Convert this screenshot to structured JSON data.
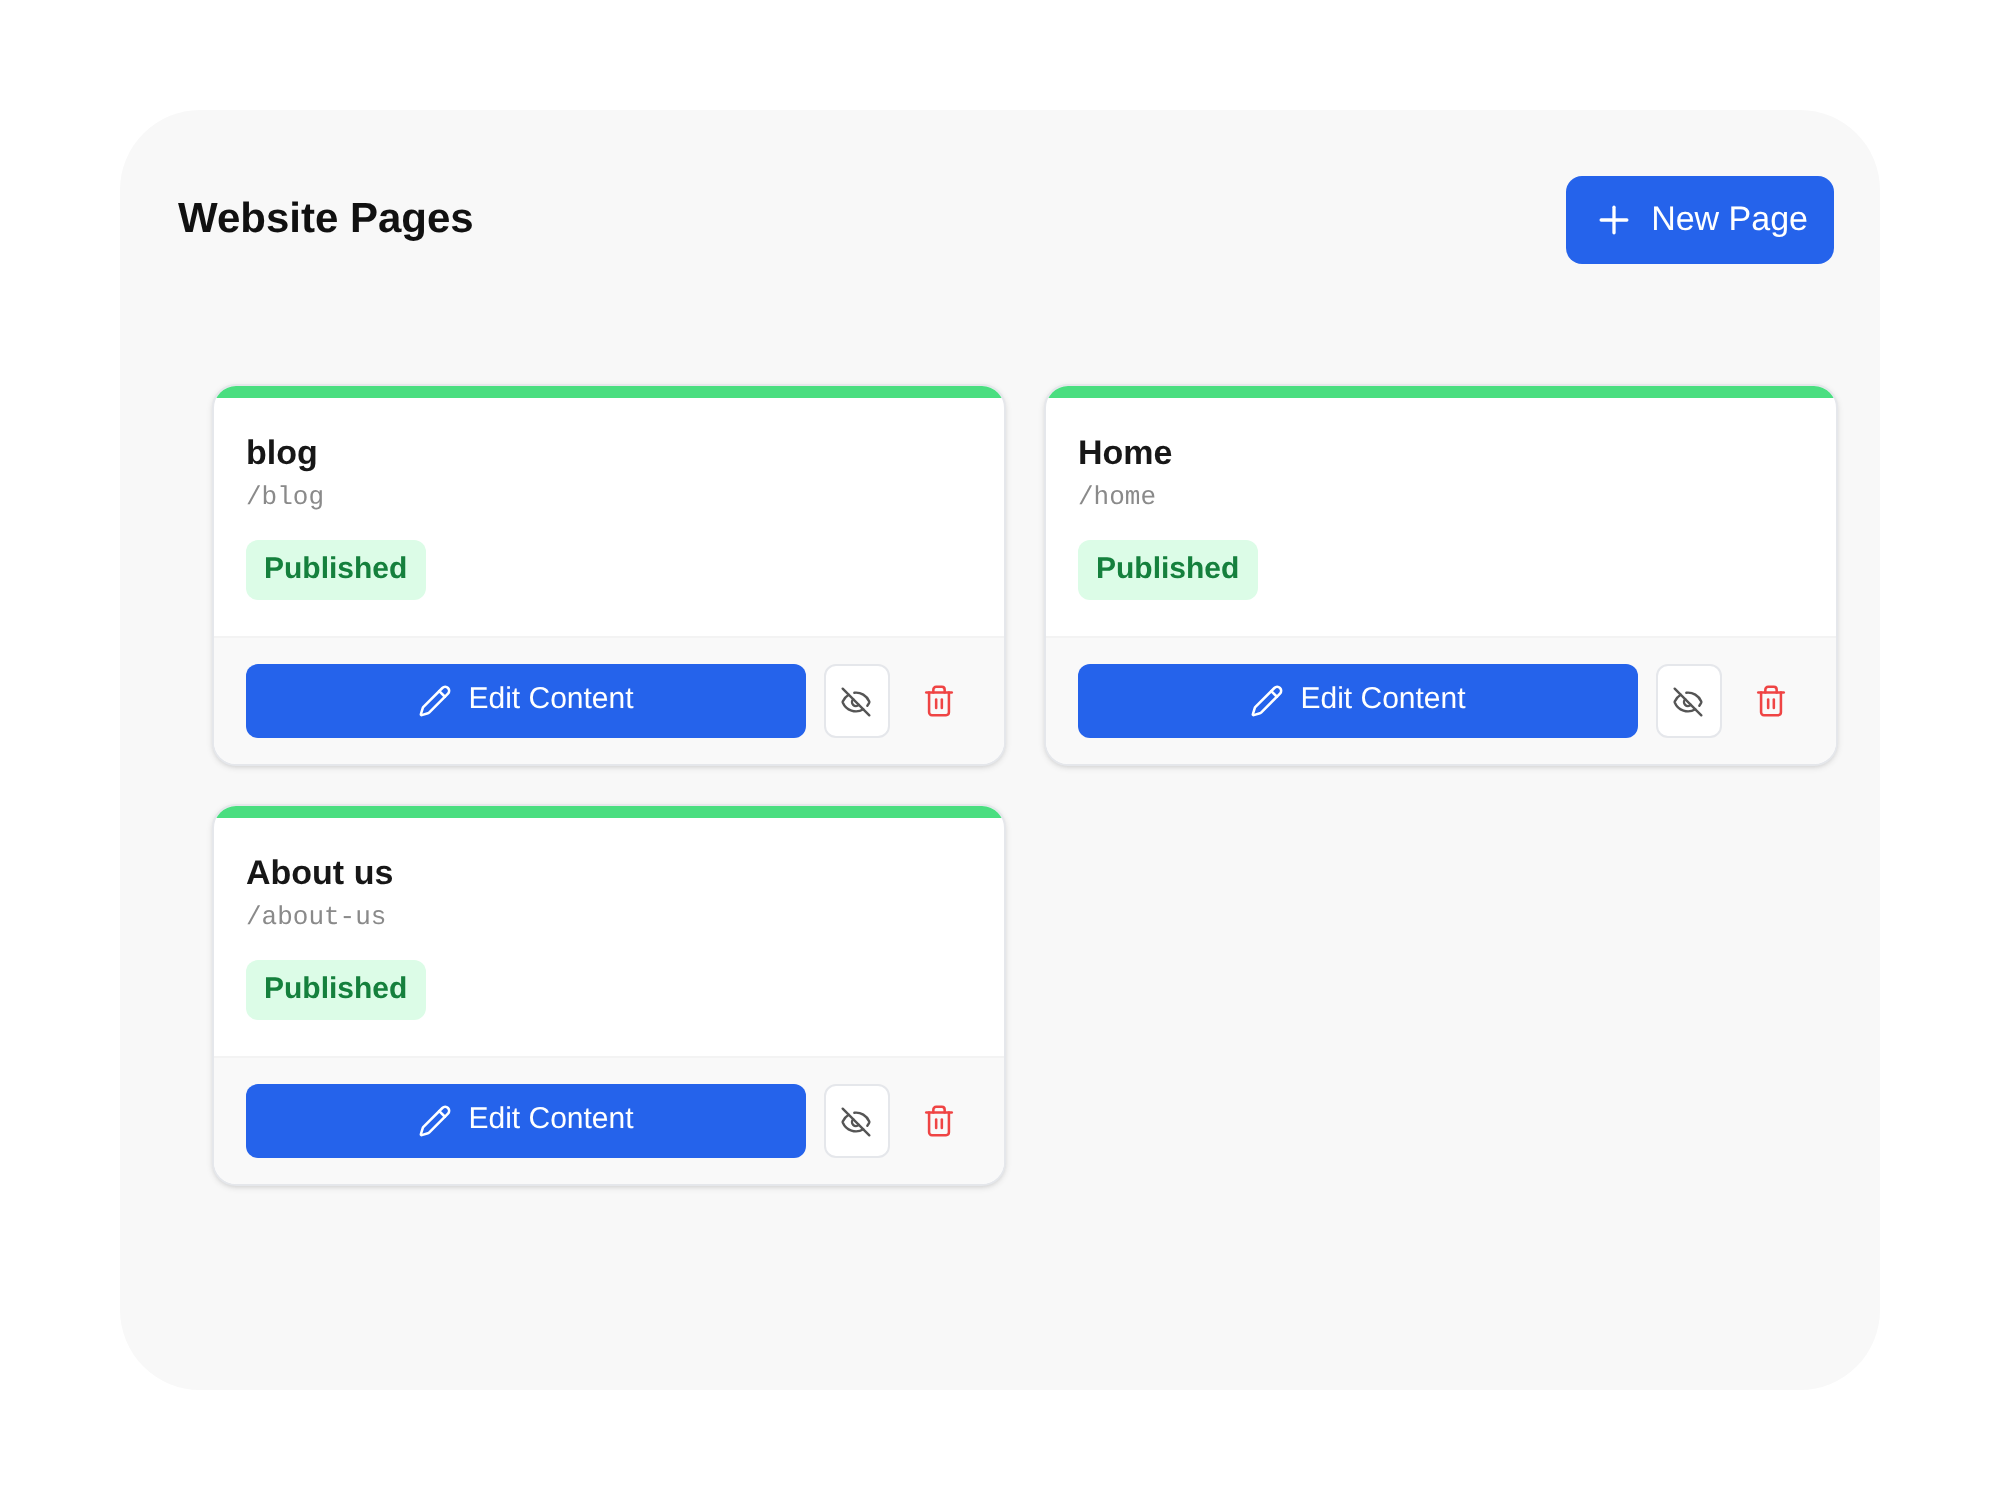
{
  "header": {
    "title": "Website Pages",
    "new_button": {
      "label": "New Page"
    }
  },
  "pages": [
    {
      "title": "blog",
      "slug": "/blog",
      "status": {
        "label": "Published",
        "kind": "published"
      },
      "edit_button": {
        "label": "Edit Content"
      }
    },
    {
      "title": "Home",
      "slug": "/home",
      "status": {
        "label": "Published",
        "kind": "published"
      },
      "edit_button": {
        "label": "Edit Content"
      }
    },
    {
      "title": "About us",
      "slug": "/about-us",
      "status": {
        "label": "Published",
        "kind": "published"
      },
      "edit_button": {
        "label": "Edit Content"
      }
    }
  ]
}
